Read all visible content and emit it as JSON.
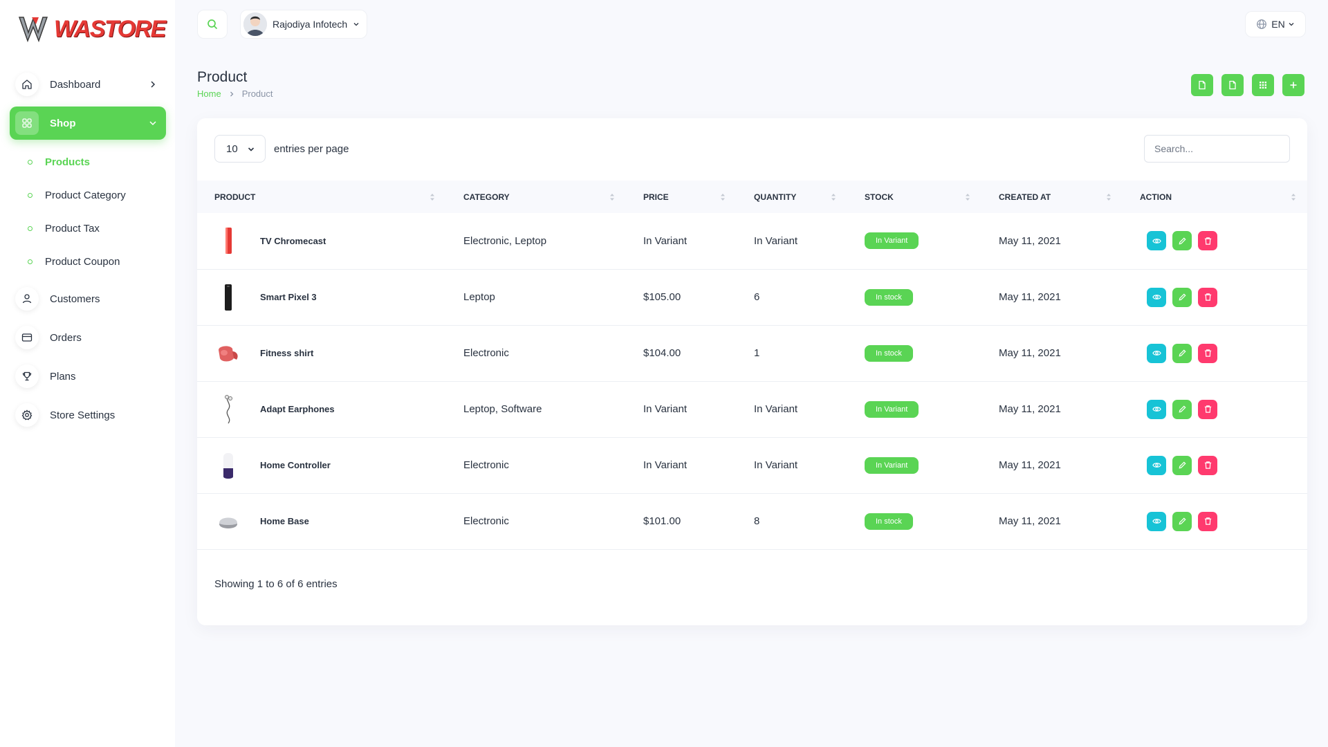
{
  "brand": {
    "name": "WASTORE"
  },
  "sidebar": {
    "items": [
      {
        "label": "Dashboard",
        "icon": "home-icon"
      },
      {
        "label": "Shop",
        "icon": "grid-icon",
        "active": true
      },
      {
        "label": "Customers",
        "icon": "user-icon"
      },
      {
        "label": "Orders",
        "icon": "credit-card-icon"
      },
      {
        "label": "Plans",
        "icon": "trophy-icon"
      },
      {
        "label": "Store Settings",
        "icon": "gear-icon"
      }
    ],
    "shop_sub": [
      {
        "label": "Products",
        "active": true
      },
      {
        "label": "Product Category"
      },
      {
        "label": "Product Tax"
      },
      {
        "label": "Product Coupon"
      }
    ]
  },
  "header": {
    "user_name": "Rajodiya Infotech",
    "language": "EN"
  },
  "page": {
    "title": "Product",
    "breadcrumb_home": "Home",
    "breadcrumb_current": "Product"
  },
  "table_controls": {
    "per_page": "10",
    "entries_label": "entries per page",
    "search_placeholder": "Search..."
  },
  "table": {
    "headers": [
      "PRODUCT",
      "CATEGORY",
      "PRICE",
      "QUANTITY",
      "STOCK",
      "CREATED AT",
      "ACTION"
    ],
    "rows": [
      {
        "name": "TV Chromecast",
        "category": "Electronic, Leptop",
        "price": "In Variant",
        "quantity": "In Variant",
        "stock": "In Variant",
        "created": "May 11, 2021",
        "thumb": "red-phone"
      },
      {
        "name": "Smart Pixel 3",
        "category": "Leptop",
        "price": "$105.00",
        "quantity": "6",
        "stock": "In stock",
        "created": "May 11, 2021",
        "thumb": "black-phone"
      },
      {
        "name": "Fitness shirt",
        "category": "Electronic",
        "price": "$104.00",
        "quantity": "1",
        "stock": "In stock",
        "created": "May 11, 2021",
        "thumb": "red-speaker"
      },
      {
        "name": "Adapt Earphones",
        "category": "Leptop, Software",
        "price": "In Variant",
        "quantity": "In Variant",
        "stock": "In Variant",
        "created": "May 11, 2021",
        "thumb": "earphones"
      },
      {
        "name": "Home Controller",
        "category": "Electronic",
        "price": "In Variant",
        "quantity": "In Variant",
        "stock": "In Variant",
        "created": "May 11, 2021",
        "thumb": "home-speaker"
      },
      {
        "name": "Home Base",
        "category": "Electronic",
        "price": "$101.00",
        "quantity": "8",
        "stock": "In stock",
        "created": "May 11, 2021",
        "thumb": "grey-speaker"
      }
    ]
  },
  "footer": {
    "showing": "Showing 1 to 6 of 6 entries"
  },
  "colors": {
    "accent": "#5ad454",
    "view": "#17c3d6",
    "delete": "#ff3a6e"
  }
}
